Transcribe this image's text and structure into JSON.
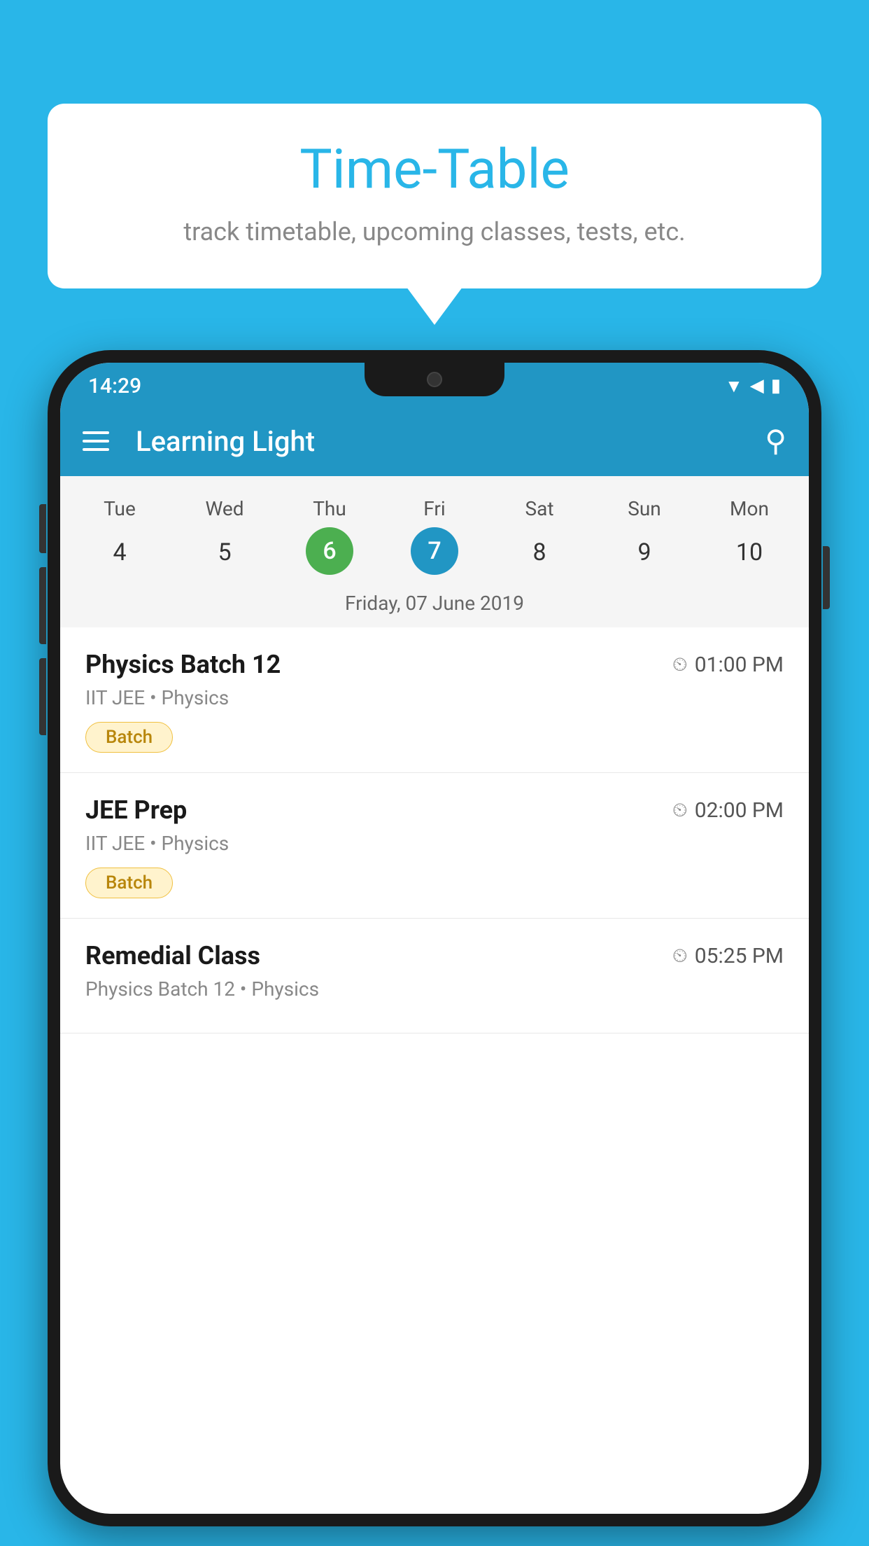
{
  "background_color": "#29b6e8",
  "speech_bubble": {
    "title": "Time-Table",
    "subtitle": "track timetable, upcoming classes, tests, etc."
  },
  "phone": {
    "status_bar": {
      "time": "14:29"
    },
    "app_bar": {
      "title": "Learning Light"
    },
    "calendar": {
      "days": [
        "Tue",
        "Wed",
        "Thu",
        "Fri",
        "Sat",
        "Sun",
        "Mon"
      ],
      "numbers": [
        "4",
        "5",
        "6",
        "7",
        "8",
        "9",
        "10"
      ],
      "today_index": 2,
      "selected_index": 3,
      "selected_date_label": "Friday, 07 June 2019"
    },
    "schedule_items": [
      {
        "title": "Physics Batch 12",
        "time": "01:00 PM",
        "subtitle": "IIT JEE • Physics",
        "badge": "Batch"
      },
      {
        "title": "JEE Prep",
        "time": "02:00 PM",
        "subtitle": "IIT JEE • Physics",
        "badge": "Batch"
      },
      {
        "title": "Remedial Class",
        "time": "05:25 PM",
        "subtitle": "Physics Batch 12 • Physics",
        "badge": null
      }
    ]
  }
}
